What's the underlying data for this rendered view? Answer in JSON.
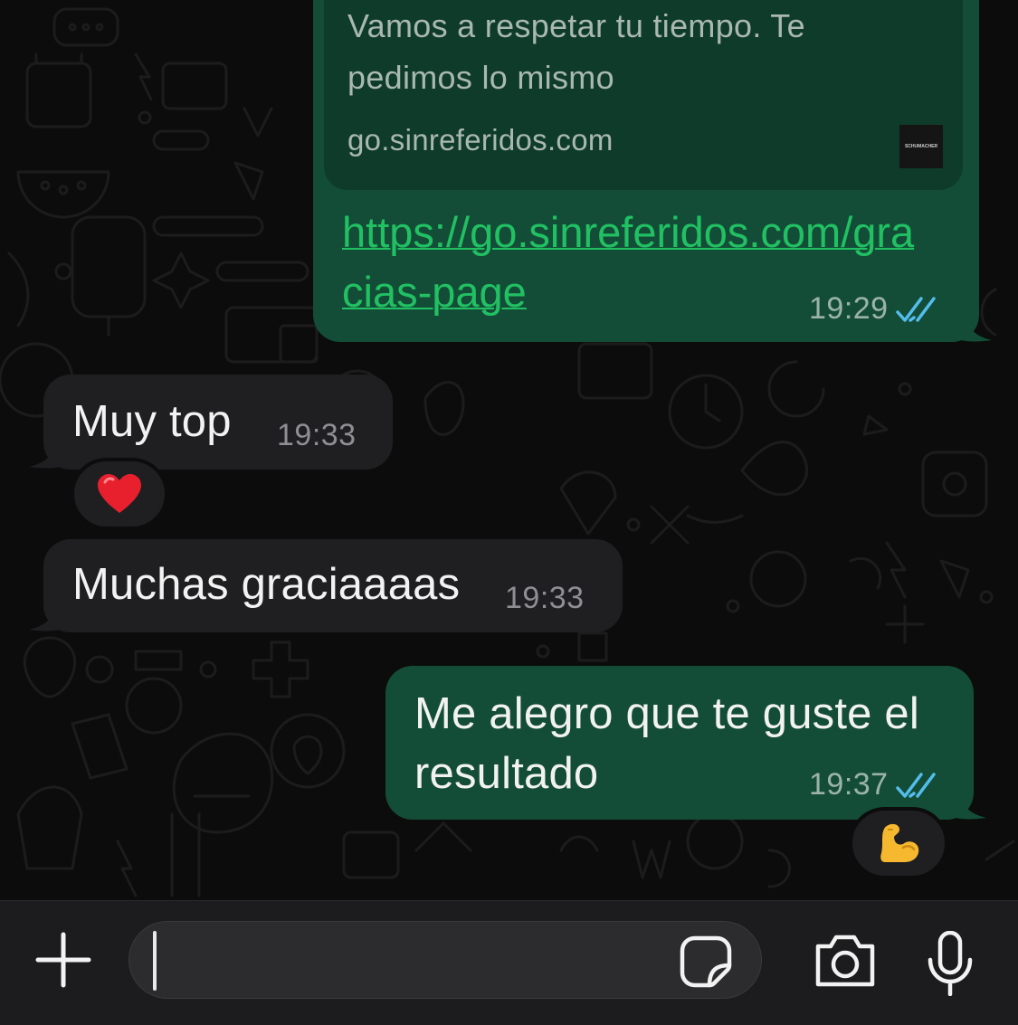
{
  "messages": [
    {
      "id": "link-message",
      "direction": "outgoing",
      "preview": {
        "description": "Vamos a respetar tu tiempo. Te pedimos lo mismo",
        "domain": "go.sinreferidos.com",
        "thumbnail_text": "SCHUMACHER"
      },
      "url": "https://go.sinreferidos.com/gracias-page",
      "time": "19:29",
      "status": "read",
      "status_icon": "double-check-icon"
    },
    {
      "id": "incoming-1",
      "direction": "incoming",
      "text": "Muy top",
      "time": "19:33",
      "reaction": "❤️"
    },
    {
      "id": "incoming-2",
      "direction": "incoming",
      "text": "Muchas graciaaaas",
      "time": "19:33"
    },
    {
      "id": "outgoing-2",
      "direction": "outgoing",
      "text": "Me alegro que te guste el resultado",
      "time": "19:37",
      "status": "read",
      "status_icon": "double-check-icon",
      "reaction": "💪"
    }
  ],
  "input_bar": {
    "value": "",
    "placeholder": "",
    "icons": [
      "plus-icon",
      "sticker-icon",
      "camera-icon",
      "microphone-icon"
    ]
  },
  "colors": {
    "outgoing_bubble": "#134d37",
    "incoming_bubble": "#1f1f21",
    "link": "#21c063",
    "read_ticks": "#53bdeb",
    "background": "#0c0c0c"
  }
}
